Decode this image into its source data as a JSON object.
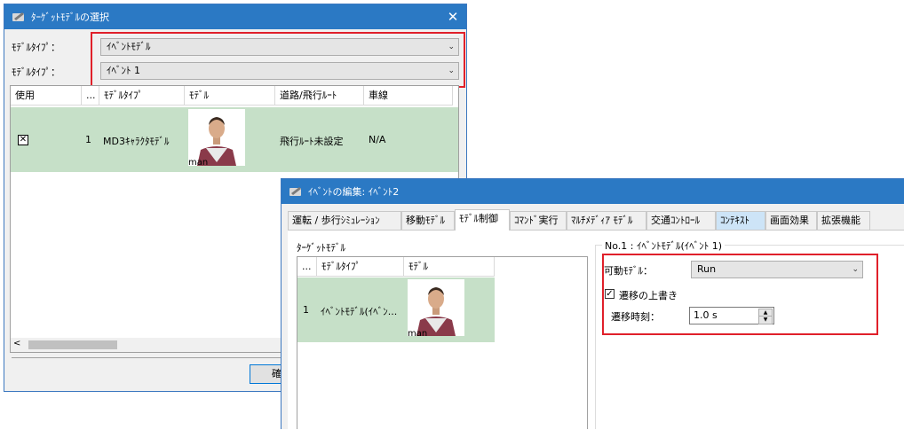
{
  "dialog1": {
    "title": "ﾀｰｹﾞｯﾄﾓﾃﾞﾙの選択",
    "model_type_label_1": "ﾓﾃﾞﾙﾀｲﾌﾟ：",
    "model_type_value_1": "ｲﾍﾞﾝﾄﾓﾃﾞﾙ",
    "model_type_label_2": "ﾓﾃﾞﾙﾀｲﾌﾟ：",
    "model_type_value_2": "ｲﾍﾞﾝﾄ 1",
    "columns": [
      "使用",
      "...",
      "ﾓﾃﾞﾙﾀｲﾌﾟ",
      "ﾓﾃﾞﾙ",
      "道路/飛行ﾙｰﾄ",
      "車線"
    ],
    "rows": [
      {
        "use_checked": true,
        "num": "1",
        "model_type": "MD3ｷｬﾗｸﾀﾓﾃﾞﾙ",
        "model_caption": "man",
        "route": "飛行ﾙｰﾄ未設定",
        "lane": "N/A"
      }
    ],
    "ok_button": "確"
  },
  "dialog2": {
    "title": "ｲﾍﾞﾝﾄの編集: ｲﾍﾞﾝﾄ2",
    "tabs": [
      "運転 / 歩行ｼﾐｭﾚｰｼｮﾝ",
      "移動ﾓﾃﾞﾙ",
      "ﾓﾃﾞﾙ制御",
      "ｺﾏﾝﾄﾞ実行",
      "ﾏﾙﾁﾒﾃﾞｨｱ ﾓﾃﾞﾙ",
      "交通ｺﾝﾄﾛｰﾙ",
      "ｺﾝﾃｷｽﾄ",
      "画面効果",
      "拡張機能"
    ],
    "selected_tab": "ﾓﾃﾞﾙ制御",
    "target_model_label": "ﾀｰｹﾞｯﾄﾓﾃﾞﾙ",
    "columns": [
      "...",
      "ﾓﾃﾞﾙﾀｲﾌﾟ",
      "ﾓﾃﾞﾙ"
    ],
    "rows": [
      {
        "num": "1",
        "model_type": "ｲﾍﾞﾝﾄﾓﾃﾞﾙ(ｲﾍﾞﾝ...",
        "model_caption": "man"
      }
    ],
    "group_title": "No.1 : ｲﾍﾞﾝﾄﾓﾃﾞﾙ(ｲﾍﾞﾝﾄ 1)",
    "motion_model_label": "可動ﾓﾃﾞﾙ：",
    "motion_model_value": "Run",
    "override_label": "遷移の上書き",
    "override_checked": true,
    "transition_time_label": "遷移時刻：",
    "transition_time_value": "1.0 s"
  },
  "colors": {
    "titlebar": "#2b79c4",
    "selected_row": "#c6e0c8",
    "highlight_box": "#e0202a"
  }
}
